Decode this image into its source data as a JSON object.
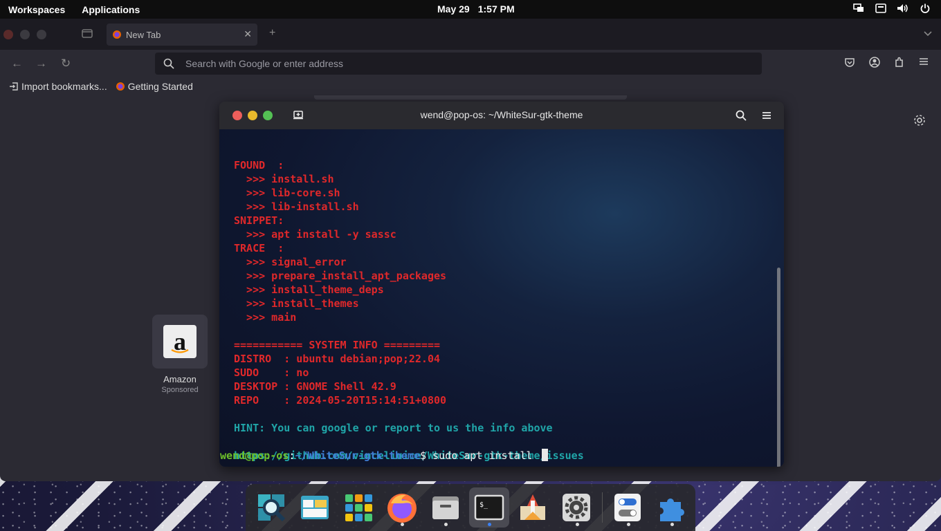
{
  "topbar": {
    "workspaces": "Workspaces",
    "applications": "Applications",
    "date": "May 29",
    "time": "1:57 PM"
  },
  "browser": {
    "tab_title": "New Tab",
    "url_placeholder": "Search with Google or enter address",
    "bookmarks": [
      "Import bookmarks...",
      "Getting Started"
    ],
    "shortcut": {
      "name": "Amazon",
      "sub": "Sponsored"
    }
  },
  "terminal": {
    "title": "wend@pop-os: ~/WhiteSur-gtk-theme",
    "lines": [
      {
        "text": "FOUND  :",
        "color": "red"
      },
      {
        "text": "  >>> install.sh",
        "color": "red"
      },
      {
        "text": "  >>> lib-core.sh",
        "color": "red"
      },
      {
        "text": "  >>> lib-install.sh",
        "color": "red"
      },
      {
        "text": "SNIPPET:",
        "color": "red"
      },
      {
        "text": "  >>> apt install -y sassc",
        "color": "red"
      },
      {
        "text": "TRACE  :",
        "color": "red"
      },
      {
        "text": "  >>> signal_error",
        "color": "red"
      },
      {
        "text": "  >>> prepare_install_apt_packages",
        "color": "red"
      },
      {
        "text": "  >>> install_theme_deps",
        "color": "red"
      },
      {
        "text": "  >>> install_themes",
        "color": "red"
      },
      {
        "text": "  >>> main",
        "color": "red"
      },
      {
        "text": "",
        "color": "red"
      },
      {
        "text": "=========== SYSTEM INFO =========",
        "color": "red"
      },
      {
        "text": "DISTRO  : ubuntu debian;pop;22.04",
        "color": "red"
      },
      {
        "text": "SUDO    : no",
        "color": "red"
      },
      {
        "text": "DESKTOP : GNOME Shell 42.9",
        "color": "red"
      },
      {
        "text": "REPO    : 2024-05-20T15:14:51+0800",
        "color": "red"
      },
      {
        "text": "",
        "color": "red"
      },
      {
        "text": "HINT: You can google or report to us the info above",
        "color": "cyan"
      },
      {
        "text": "",
        "color": "red"
      },
      {
        "text": "https://github.com/vinceliuice/WhiteSur-gtk-theme/issues",
        "color": "cyan"
      }
    ],
    "prompt_user": "wend@pop-os",
    "prompt_sep": ":",
    "prompt_path": "~/WhiteSur-gtk-theme",
    "prompt_dollar": "$",
    "command": " sudo apt install "
  },
  "dock": {
    "apps": [
      {
        "icon": "magnifier-icon",
        "running": false
      },
      {
        "icon": "window-manager-icon",
        "running": false
      },
      {
        "icon": "app-grid-icon",
        "running": false
      },
      {
        "icon": "firefox-icon",
        "running": true
      },
      {
        "icon": "files-icon",
        "running": true
      },
      {
        "icon": "terminal-icon",
        "running": true,
        "active": true
      },
      {
        "icon": "shop-icon",
        "running": false
      },
      {
        "icon": "settings-icon",
        "running": true
      },
      {
        "icon": "tweaks-icon",
        "running": true
      },
      {
        "icon": "extensions-icon",
        "running": true
      }
    ]
  }
}
